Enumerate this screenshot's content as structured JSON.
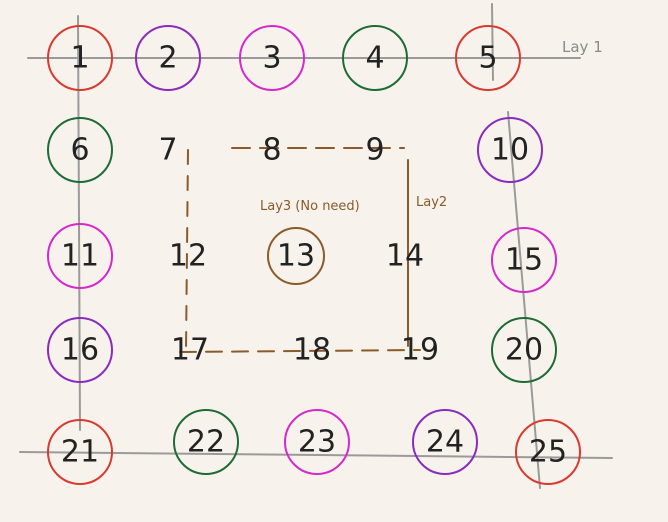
{
  "labels": {
    "layer1": "Lay 1",
    "layer2": "Lay2",
    "layer3": "Lay3 (No need)"
  },
  "colors": {
    "background": "#f7f3ec",
    "red": "#d93a2f",
    "purple": "#8a2bbf",
    "magenta": "#d42ac9",
    "green": "#1e6b35",
    "brown": "#8a5a2b",
    "gray": "#9a9a9a",
    "ink": "#222222"
  },
  "nodes": [
    {
      "n": "1",
      "ring": "red"
    },
    {
      "n": "2",
      "ring": "purple"
    },
    {
      "n": "3",
      "ring": "magenta"
    },
    {
      "n": "4",
      "ring": "green"
    },
    {
      "n": "5",
      "ring": "red"
    },
    {
      "n": "6",
      "ring": "green"
    },
    {
      "n": "7",
      "ring": null
    },
    {
      "n": "8",
      "ring": null
    },
    {
      "n": "9",
      "ring": null
    },
    {
      "n": "10",
      "ring": "purple"
    },
    {
      "n": "11",
      "ring": "magenta"
    },
    {
      "n": "12",
      "ring": null
    },
    {
      "n": "13",
      "ring": "brown"
    },
    {
      "n": "14",
      "ring": null
    },
    {
      "n": "15",
      "ring": "magenta"
    },
    {
      "n": "16",
      "ring": "purple"
    },
    {
      "n": "17",
      "ring": null
    },
    {
      "n": "18",
      "ring": null
    },
    {
      "n": "19",
      "ring": null
    },
    {
      "n": "20",
      "ring": "green"
    },
    {
      "n": "21",
      "ring": "red"
    },
    {
      "n": "22",
      "ring": "green"
    },
    {
      "n": "23",
      "ring": "magenta"
    },
    {
      "n": "24",
      "ring": "purple"
    },
    {
      "n": "25",
      "ring": "red"
    }
  ]
}
